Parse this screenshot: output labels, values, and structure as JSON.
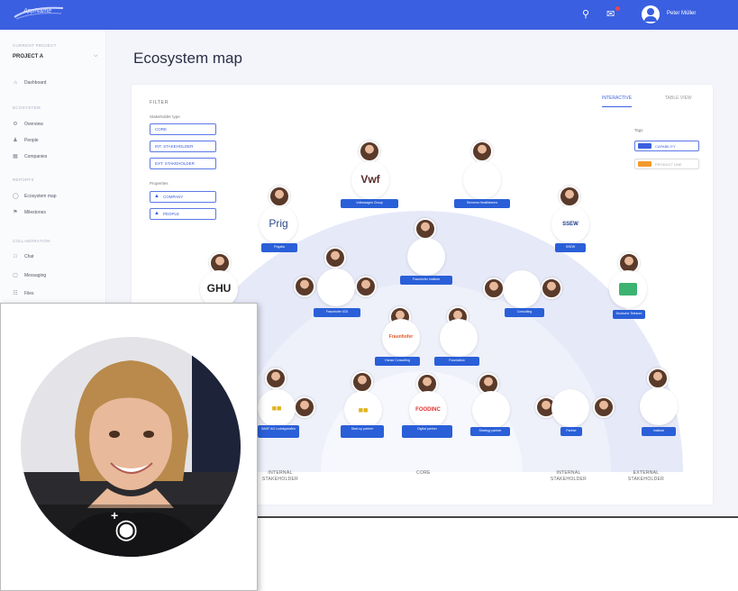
{
  "app": {
    "logo_text": "AppName",
    "user_name": "Peter Müller"
  },
  "sidebar": {
    "project_section": "CURRENT PROJECT",
    "project_name": "PROJECT A",
    "dashboard": "Dashboard",
    "ecosystem_section": "ECOSYSTEM",
    "overview": "Overview",
    "people": "People",
    "companies": "Companies",
    "reports_section": "REPORTS",
    "ecosystem_map": "Ecosystem map",
    "milestones": "Milestones",
    "collab_section": "COLLABORATION",
    "chat": "Chat",
    "messaging": "Messaging",
    "files": "Files"
  },
  "page": {
    "title": "Ecosystem map"
  },
  "filter": {
    "title": "FILTER",
    "stakeholder_label": "Stakeholder type",
    "chips": [
      "CORE",
      "INT. STAKEHOLDER",
      "EXT. STAKEHOLDER"
    ],
    "properties_label": "Properties",
    "prop_chips": [
      "COMPANY",
      "PEOPLE"
    ]
  },
  "tabs": {
    "interactive": "INTERACTIVE",
    "table": "TABLE VIEW"
  },
  "tags": {
    "title": "Tags",
    "capability": "CAPABILITY",
    "second": "PRODUCT LINE"
  },
  "colors": {
    "brand": "#3a5fe0",
    "pill": "#2a5fd8",
    "outer_ring": "#e6e9f8",
    "middle_ring": "#eef0fa",
    "inner_ring": "#f6f7fc"
  },
  "nodes": [
    {
      "logo": "Vwf",
      "pill": "Volkswagen Group"
    },
    {
      "logo": "",
      "pill": "Siemens Healthineers"
    },
    {
      "logo": "Prig",
      "pill": "Prigalia"
    },
    {
      "logo": "SSEW",
      "pill": "SSEW"
    },
    {
      "logo": "",
      "pill": "Fraunhofer Institute"
    },
    {
      "logo": "GHU",
      "pill": "GHU University"
    },
    {
      "logo": "",
      "pill": "Deutsche Telekom"
    },
    {
      "logo": "",
      "pill": "Fraunhofer IGD"
    },
    {
      "logo": "",
      "pill": "Consulting"
    },
    {
      "logo": "",
      "pill": "Foundation"
    },
    {
      "logo": "Fraunhofer",
      "pill": "Hanse Consulting"
    },
    {
      "logo": "",
      "pill": "BASF AG Ludwigshafen"
    },
    {
      "logo": "",
      "pill": "Start-up partner"
    },
    {
      "logo": "",
      "pill": "Digital partner"
    },
    {
      "logo": "FOODINC",
      "pill": "Foodinc Group"
    },
    {
      "logo": "",
      "pill": "Strategy partner"
    },
    {
      "logo": "",
      "pill": "Partner"
    },
    {
      "logo": "",
      "pill": "Institute"
    }
  ],
  "rings": {
    "internal_left": "INTERNAL\nSTAKEHOLDER",
    "core": "CORE",
    "internal_right": "INTERNAL\nSTAKEHOLDER",
    "external": "EXTERNAL\nSTAKEHOLDER"
  }
}
